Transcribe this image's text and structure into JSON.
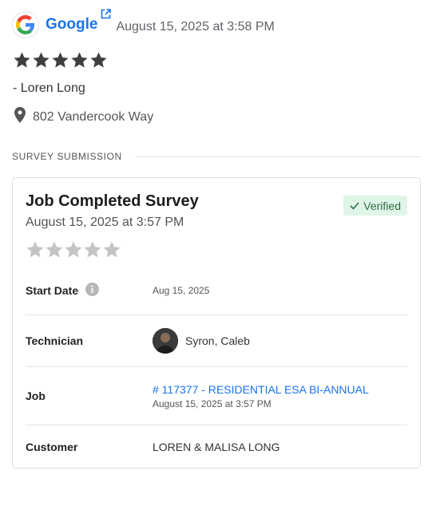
{
  "review": {
    "source": "Google",
    "date": "August 15, 2025 at 3:58 PM",
    "rating": 5,
    "reviewer": "- Loren Long",
    "address": "802 Vandercook Way"
  },
  "section_label": "SURVEY SUBMISSION",
  "card": {
    "title": "Job Completed Survey",
    "date": "August 15, 2025 at 3:57 PM",
    "badge": "Verified",
    "rating": 0,
    "rows": {
      "start_date": {
        "label": "Start Date",
        "value": "Aug 15, 2025"
      },
      "technician": {
        "label": "Technician",
        "value": "Syron, Caleb"
      },
      "job": {
        "label": "Job",
        "link": "# 117377 - RESIDENTIAL ESA BI-ANNUAL",
        "date": "August 15, 2025 at 3:57 PM"
      },
      "customer": {
        "label": "Customer",
        "value": "LOREN & MALISA LONG"
      }
    }
  },
  "colors": {
    "link": "#1a73e8",
    "star_filled": "#3f3f3f",
    "star_empty": "#c4c4c4",
    "verified_bg": "#dff5e7",
    "verified_text": "#2f6e44"
  },
  "icons": [
    "google-logo",
    "external-link-icon",
    "star-icon",
    "location-pin-icon",
    "check-icon",
    "info-icon"
  ]
}
